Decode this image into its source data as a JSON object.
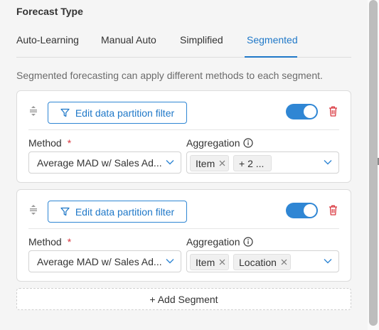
{
  "panel": {
    "title": "Forecast Type",
    "tabs": [
      {
        "label": "Auto-Learning",
        "active": false
      },
      {
        "label": "Manual Auto",
        "active": false
      },
      {
        "label": "Simplified",
        "active": false
      },
      {
        "label": "Segmented",
        "active": true
      }
    ],
    "description": "Segmented forecasting can apply different methods to each segment."
  },
  "segments": [
    {
      "filter_button": "Edit data partition filter",
      "toggle_on": true,
      "method_label": "Method",
      "required_mark": "*",
      "method_value": "Average MAD w/ Sales Ad...",
      "aggregation_label": "Aggregation",
      "aggregation_tags": [
        "Item",
        "+ 2 ..."
      ]
    },
    {
      "filter_button": "Edit data partition filter",
      "toggle_on": true,
      "method_label": "Method",
      "required_mark": "*",
      "method_value": "Average MAD w/ Sales Ad...",
      "aggregation_label": "Aggregation",
      "aggregation_tags": [
        "Item",
        "Location"
      ]
    }
  ],
  "add_segment_label": "+ Add Segment",
  "colors": {
    "accent": "#1f78c8",
    "toggle": "#2f86d4",
    "danger": "#d9363e",
    "background": "#f5f5f5"
  },
  "icons": [
    "drag-handle-icon",
    "filter-icon",
    "trash-icon",
    "info-icon",
    "chevron-down-icon",
    "close-icon"
  ]
}
